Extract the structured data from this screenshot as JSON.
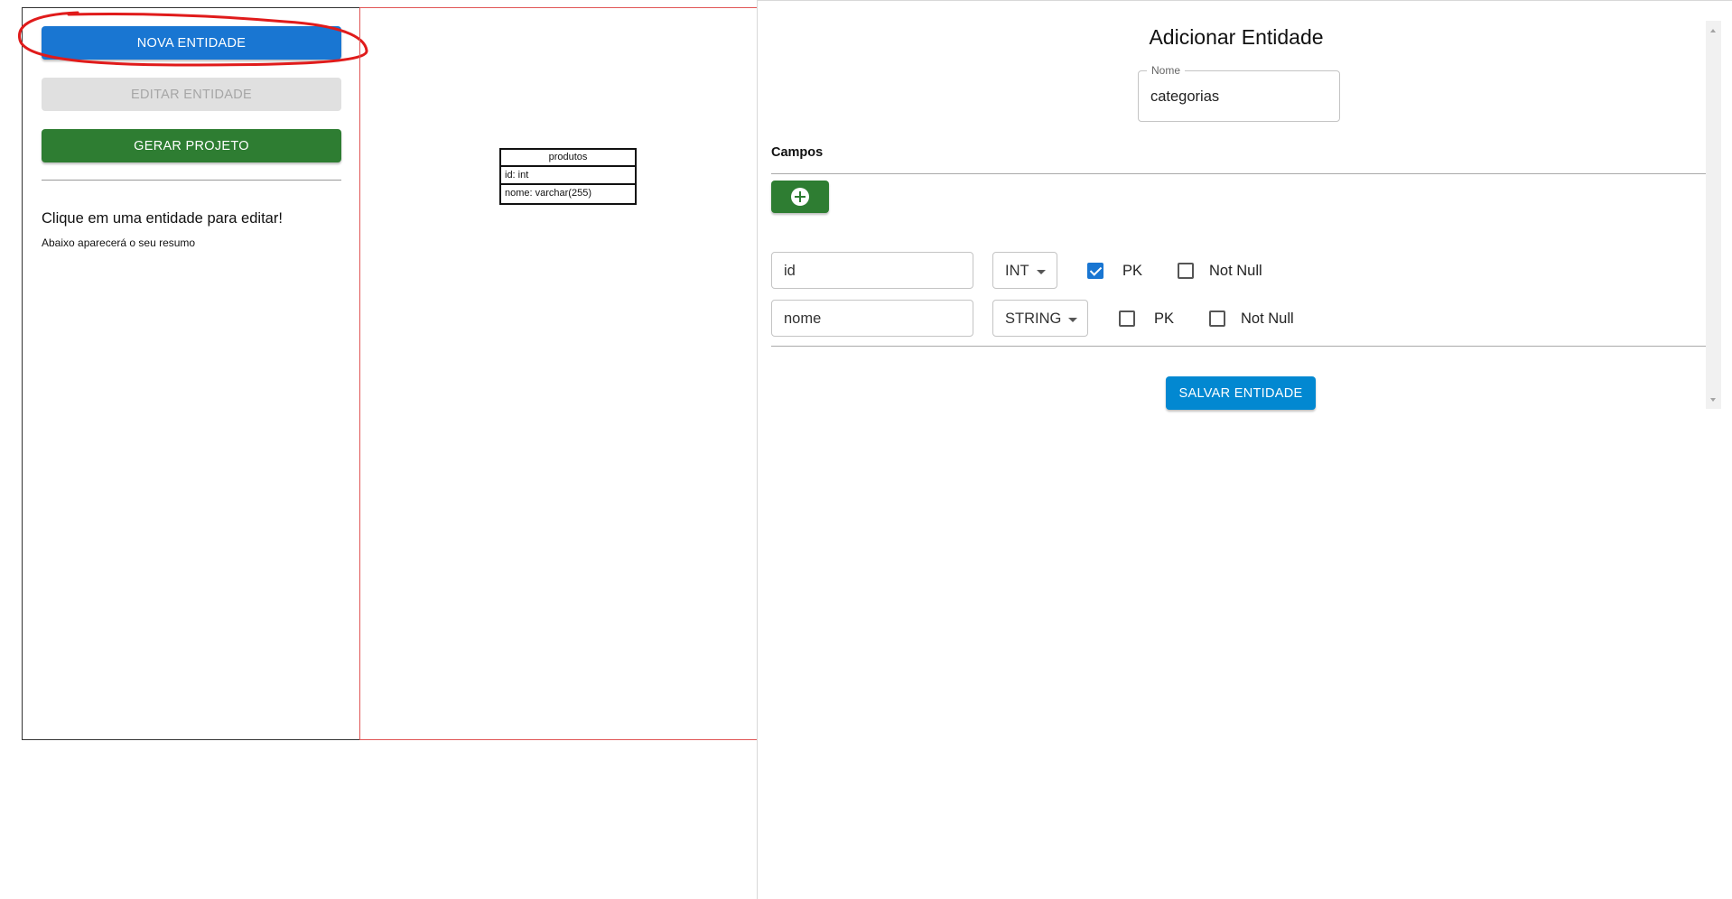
{
  "sidebar": {
    "new_entity_label": "NOVA ENTIDADE",
    "edit_entity_label": "EDITAR ENTIDADE",
    "generate_project_label": "GERAR PROJETO",
    "hint_title": "Clique em uma entidade para editar!",
    "hint_subtitle": "Abaixo aparecerá o seu resumo"
  },
  "canvas": {
    "entity": {
      "name": "produtos",
      "fields": [
        "id: int",
        "nome: varchar(255)"
      ]
    }
  },
  "dialog": {
    "title": "Adicionar Entidade",
    "name_label": "Nome",
    "name_value": "categorias",
    "fields_section_title": "Campos",
    "fields": [
      {
        "name": "id",
        "type": "INT",
        "pk_label": "PK",
        "pk": true,
        "not_null_label": "Not Null",
        "not_null": false
      },
      {
        "name": "nome",
        "type": "STRING",
        "pk_label": "PK",
        "pk": false,
        "not_null_label": "Not Null",
        "not_null": false
      }
    ],
    "save_label": "SALVAR ENTIDADE"
  },
  "colors": {
    "primary": "#1976d2",
    "success": "#2e7d32",
    "save": "#0288d1",
    "annotation": "#e01b1b"
  }
}
